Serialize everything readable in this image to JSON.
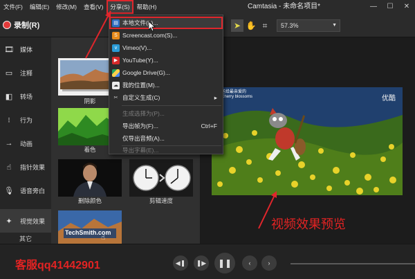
{
  "menubar": {
    "items": [
      "文件(F)",
      "编辑(E)",
      "修改(M)",
      "查看(V)",
      "分享(S)",
      "帮助(H)"
    ],
    "app_title": "Camtasia - 未命名项目*"
  },
  "toolbar": {
    "record_label": "录制(R)",
    "zoom_value": "57.3%"
  },
  "sidebar": {
    "items": [
      "媒体",
      "注释",
      "转场",
      "行为",
      "动画",
      "指针效果",
      "语音旁白",
      "视觉效果"
    ],
    "more_label": "其它"
  },
  "gallery": {
    "items": [
      "阴影",
      "着色",
      "删除颜色",
      "剪辑速度",
      ""
    ],
    "techsmith_text": "TechSmith.com"
  },
  "share_menu": {
    "items": [
      {
        "label": "本地文件(L)...",
        "shortcut": "",
        "icon": "local-file-icon",
        "disabled": false
      },
      {
        "label": "Screencast.com(S)...",
        "shortcut": "",
        "icon": "screencast-icon",
        "disabled": false
      },
      {
        "label": "Vimeo(V)...",
        "shortcut": "",
        "icon": "vimeo-icon",
        "disabled": false
      },
      {
        "label": "YouTube(Y)...",
        "shortcut": "",
        "icon": "youtube-icon",
        "disabled": false
      },
      {
        "label": "Google Drive(G)...",
        "shortcut": "",
        "icon": "google-drive-icon",
        "disabled": false
      },
      {
        "label": "我的位置(M)...",
        "shortcut": "",
        "icon": "my-place-icon",
        "disabled": false
      },
      {
        "label": "自定义生成(C)",
        "shortcut": "",
        "icon": "custom-produce-icon",
        "disabled": false
      },
      {
        "label": "生成选择为(P)...",
        "shortcut": "",
        "icon": "",
        "disabled": true
      },
      {
        "label": "导出帧为(F)...",
        "shortcut": "Ctrl+F",
        "icon": "",
        "disabled": false
      },
      {
        "label": "仅导出音频(A)...",
        "shortcut": "",
        "icon": "",
        "disabled": false
      },
      {
        "label": "导出字幕(E)...",
        "shortcut": "",
        "icon": "",
        "disabled": true
      }
    ]
  },
  "preview": {
    "watermark": "优酷",
    "title_line1": "送给最亲爱的",
    "title_line2": "Cherry blossoms"
  },
  "annotations": {
    "preview_label": "视频效果预览",
    "contact": "客服qq41442901"
  },
  "colors": {
    "accent_red": "#e0262c",
    "record_red": "#e23a3a",
    "selection_yellow": "#e2d84a"
  }
}
